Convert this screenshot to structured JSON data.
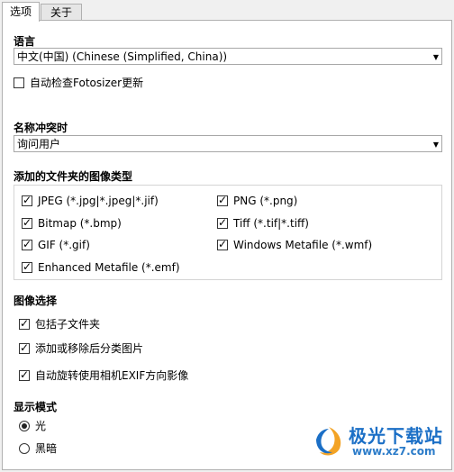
{
  "tabs": [
    "选项",
    "关于"
  ],
  "language": {
    "label": "语言",
    "selected": "中文(中国) (Chinese (Simplified, China))",
    "auto_update_label": "自动检查Fotosizer更新",
    "auto_update_checked": false
  },
  "conflict": {
    "label": "名称冲突时",
    "selected": "询问用户"
  },
  "image_types": {
    "label": "添加的文件夹的图像类型",
    "items": [
      {
        "label": "JPEG (*.jpg|*.jpeg|*.jif)",
        "checked": true
      },
      {
        "label": "PNG (*.png)",
        "checked": true
      },
      {
        "label": "Bitmap (*.bmp)",
        "checked": true
      },
      {
        "label": "Tiff (*.tif|*.tiff)",
        "checked": true
      },
      {
        "label": "GIF (*.gif)",
        "checked": true
      },
      {
        "label": "Windows Metafile (*.wmf)",
        "checked": true
      },
      {
        "label": "Enhanced Metafile (*.emf)",
        "checked": true
      }
    ]
  },
  "image_selection": {
    "label": "图像选择",
    "items": [
      {
        "label": "包括子文件夹",
        "checked": true
      },
      {
        "label": "添加或移除后分类图片",
        "checked": true
      },
      {
        "label": "自动旋转使用相机EXIF方向影像",
        "checked": true
      }
    ]
  },
  "display_mode": {
    "label": "显示模式",
    "options": [
      "光",
      "黑暗"
    ],
    "selected": "光"
  },
  "watermark": {
    "text": "极光下载站",
    "url": "www.xz7.com"
  },
  "icons": {
    "dropdown": "chevron-down-icon",
    "check": "check-icon"
  }
}
